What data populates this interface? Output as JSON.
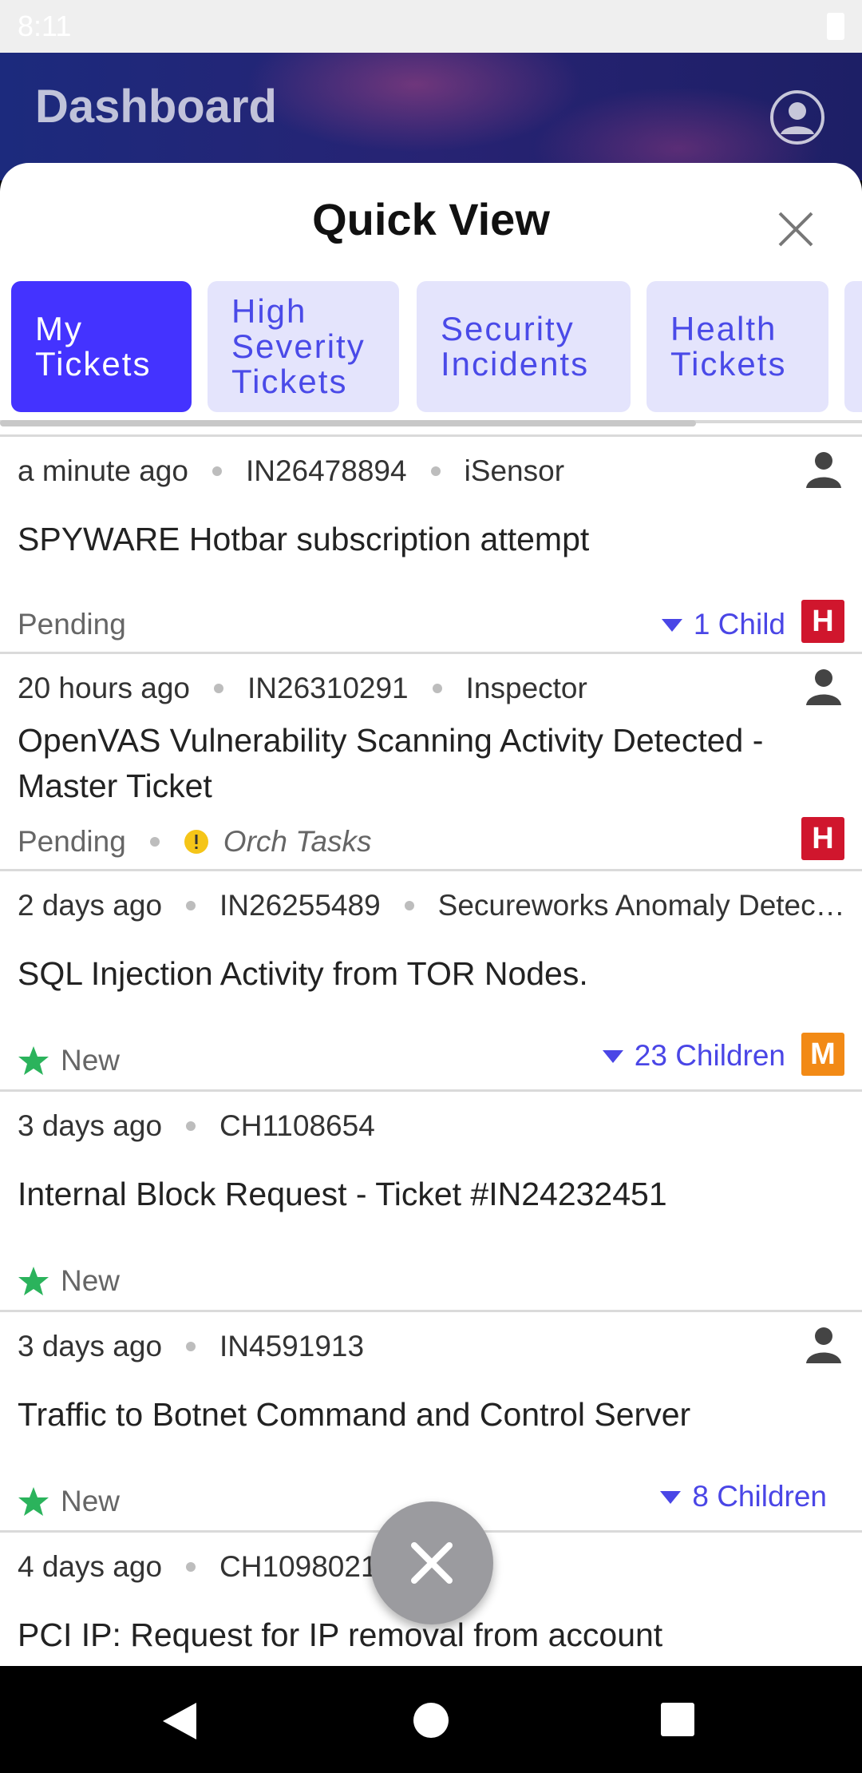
{
  "status_bar": {
    "time": "8:11"
  },
  "header": {
    "title": "Dashboard"
  },
  "sheet": {
    "title": "Quick View"
  },
  "tabs": [
    {
      "label": "My\nTickets",
      "active": true
    },
    {
      "label": "High\nSeverity\nTickets",
      "active": false
    },
    {
      "label": "Security\nIncidents",
      "active": false
    },
    {
      "label": "Health\nTickets",
      "active": false
    }
  ],
  "tickets": [
    {
      "time": "a minute ago",
      "id": "IN26478894",
      "source": "iSensor",
      "title": "SPYWARE Hotbar subscription attempt",
      "status": "Pending",
      "children": "1 Child",
      "severity": "H"
    },
    {
      "time": "20 hours ago",
      "id": "IN26310291",
      "source": "Inspector",
      "title": "OpenVAS Vulnerability Scanning Activity Detected - Master Ticket",
      "status": "Pending",
      "extra": "Orch Tasks",
      "severity": "H"
    },
    {
      "time": "2 days ago",
      "id": "IN26255489",
      "source": "Secureworks Anomaly Detec…",
      "title": "SQL Injection Activity from TOR Nodes.",
      "status": "New",
      "children": "23 Children",
      "severity": "M"
    },
    {
      "time": "3 days ago",
      "id": "CH1108654",
      "title": "Internal Block Request - Ticket #IN24232451",
      "status": "New"
    },
    {
      "time": "3 days ago",
      "id": "IN4591913",
      "title": "Traffic to Botnet Command and Control Server",
      "status": "New",
      "children": "8 Children"
    },
    {
      "time": "4 days ago",
      "id": "CH1098021",
      "title": "PCI IP: Request for IP removal from account"
    }
  ],
  "colors": {
    "accent": "#4433ff",
    "high": "#d0162d",
    "medium": "#f28a16",
    "new_star": "#2bb35c",
    "warning": "#f5c518"
  }
}
